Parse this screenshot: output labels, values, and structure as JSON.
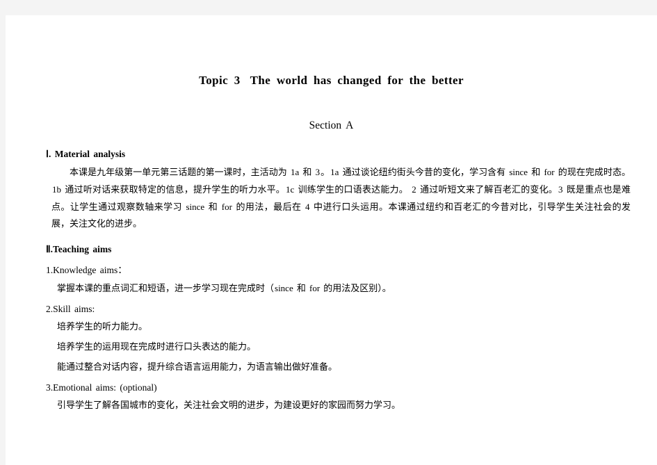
{
  "document": {
    "title_topic": "Topic 3",
    "title_text": "The world has changed for the better",
    "section": "Section A",
    "sections": [
      {
        "heading": "Ⅰ. Material analysis",
        "paragraph_parts": [
          {
            "type": "cjk",
            "text": "本课是九年级第一单元第三话题的第一课时，主活动为 "
          },
          {
            "type": "en",
            "text": "1a"
          },
          {
            "type": "cjk",
            "text": " 和 "
          },
          {
            "type": "en",
            "text": "3"
          },
          {
            "type": "cjk",
            "text": "。"
          },
          {
            "type": "en",
            "text": "1a"
          },
          {
            "type": "cjk",
            "text": " 通过谈论纽约街头今昔的变化，学习含有 "
          },
          {
            "type": "en",
            "text": "since"
          },
          {
            "type": "cjk",
            "text": " 和 "
          },
          {
            "type": "en",
            "text": "for"
          },
          {
            "type": "cjk",
            "text": " 的现在完成时态。"
          },
          {
            "type": "en",
            "text": "1b"
          },
          {
            "type": "cjk",
            "text": " 通过听对话来获取特定的信息，提升学生的听力水平。"
          },
          {
            "type": "en",
            "text": "1c"
          },
          {
            "type": "cjk",
            "text": " 训练学生的口语表达能力。 "
          },
          {
            "type": "en",
            "text": "2"
          },
          {
            "type": "cjk",
            "text": " 通过听短文来了解百老汇的变化。"
          },
          {
            "type": "en",
            "text": "3"
          },
          {
            "type": "cjk",
            "text": " 既是重点也是难点。让学生通过观察数轴来学习 "
          },
          {
            "type": "en",
            "text": "since"
          },
          {
            "type": "cjk",
            "text": " 和 "
          },
          {
            "type": "en",
            "text": "for"
          },
          {
            "type": "cjk",
            "text": " 的用法，最后在 "
          },
          {
            "type": "en",
            "text": "4"
          },
          {
            "type": "cjk",
            "text": " 中进行口头运用。本课通过纽约和百老汇的今昔对比，引导学生关注社会的发展，关注文化的进步。"
          }
        ]
      }
    ],
    "teaching_aims": {
      "heading": "Ⅱ.Teaching aims",
      "groups": [
        {
          "label": "1.Knowledge aims：",
          "lines": [
            [
              {
                "type": "cjk",
                "text": "掌握本课的重点词汇和短语，进一步学习现在完成时（"
              },
              {
                "type": "en",
                "text": "since"
              },
              {
                "type": "cjk",
                "text": " 和 "
              },
              {
                "type": "en",
                "text": "for"
              },
              {
                "type": "cjk",
                "text": " 的用法及区别）。"
              }
            ]
          ]
        },
        {
          "label": "2.Skill aims:",
          "lines": [
            [
              {
                "type": "cjk",
                "text": "培养学生的听力能力。"
              }
            ],
            [
              {
                "type": "cjk",
                "text": "培养学生的运用现在完成时进行口头表达的能力。"
              }
            ],
            [
              {
                "type": "cjk",
                "text": "能通过整合对话内容，提升综合语言运用能力，为语言输出做好准备。"
              }
            ]
          ]
        },
        {
          "label": "3.Emotional aims: (optional)",
          "lines": [
            [
              {
                "type": "cjk",
                "text": "引导学生了解各国城市的变化，关注社会文明的进步，为建设更好的家园而努力学习。"
              }
            ]
          ]
        }
      ]
    }
  }
}
